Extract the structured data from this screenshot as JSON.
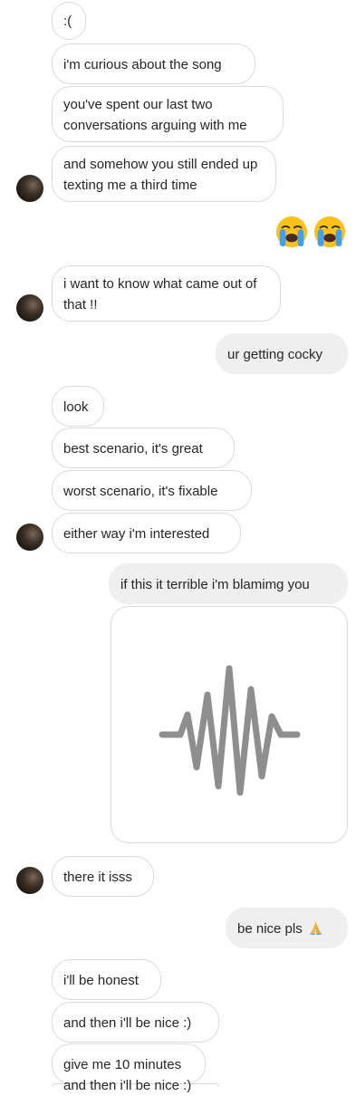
{
  "messages": {
    "m1": ":(",
    "m2": "i'm curious about the song",
    "m3": "you've spent our last two conversations arguing with me",
    "m4": "and somehow you still ended up texting me a third time",
    "m5": "i want to know what came out of that !!",
    "m6": "ur getting cocky",
    "m7": "look",
    "m8": "best scenario, it's great",
    "m9": "worst scenario, it's fixable",
    "m10": "either way i'm interested",
    "m11": "if this it terrible i'm blamimg you",
    "m12": "there it isss",
    "m13": "be nice pls",
    "m14": "i'll be honest",
    "m15": "and then i'll be nice :)",
    "m16": "give me 10 minutes",
    "m17": "and then i'll be nice :)"
  },
  "icons": {
    "reaction": "loudly-crying-face-emoji",
    "audio": "waveform-icon",
    "pray": "folded-hands-emoji"
  },
  "colors": {
    "incoming_border": "#dbdbdb",
    "outgoing_bg": "#efefef",
    "waveform": "#8e8e8e"
  }
}
